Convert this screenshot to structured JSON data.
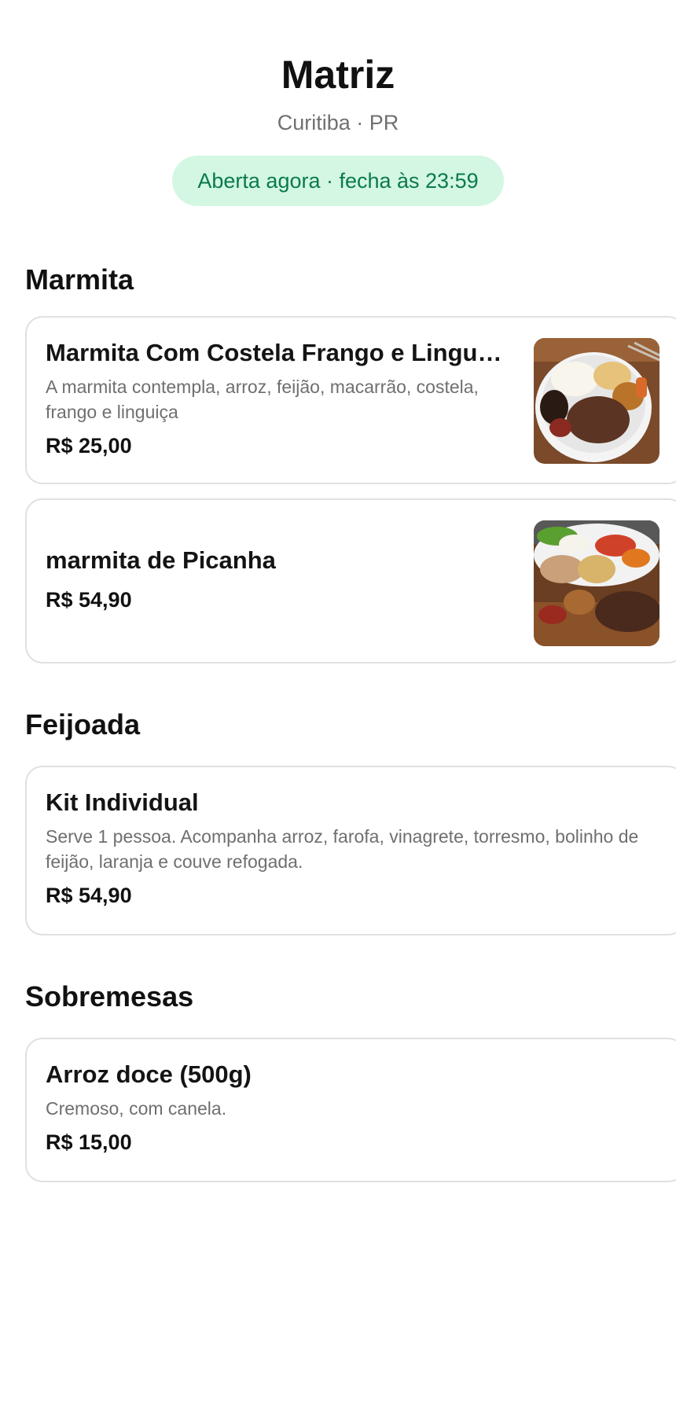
{
  "store": {
    "title": "Matriz",
    "location": "Curitiba · PR",
    "status": "Aberta agora · fecha às 23:59"
  },
  "sections": [
    {
      "title": "Marmita",
      "items": [
        {
          "name": "Marmita Com Costela Frango e Linguiça",
          "description": "A marmita contempla, arroz, feijão, macarrão, costela, frango e linguiça",
          "price": "R$ 25,00",
          "image": "marmita-costela-photo"
        },
        {
          "name": "marmita de Picanha",
          "description": "",
          "price": "R$ 54,90",
          "image": "marmita-picanha-photo"
        }
      ]
    },
    {
      "title": "Feijoada",
      "items": [
        {
          "name": "Kit Individual",
          "description": "Serve 1 pessoa. Acompanha arroz, farofa, vinagrete, torresmo, bolinho de feijão, laranja e couve refogada.",
          "price": "R$ 54,90"
        }
      ]
    },
    {
      "title": "Sobremesas",
      "items": [
        {
          "name": "Arroz doce (500g)",
          "description": "Cremoso, com canela.",
          "price": "R$ 15,00"
        }
      ]
    }
  ],
  "colors": {
    "status_bg": "#d3f7e3",
    "status_text": "#0a7a4a",
    "card_border": "#e0e0e0"
  }
}
